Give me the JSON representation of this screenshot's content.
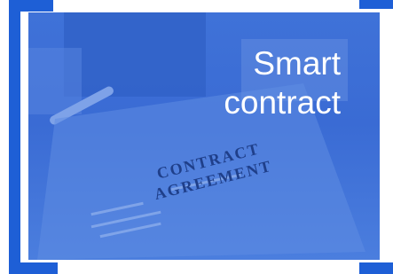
{
  "title_lines": [
    "Smart",
    "contract"
  ],
  "document": {
    "line1": "CONTRACT",
    "line2": "AGREEMENT"
  },
  "colors": {
    "accent": "#1e5fd6",
    "overlay": "#3a6bd4",
    "text": "#ffffff"
  },
  "icons": [
    "bracket-frame-icon"
  ]
}
